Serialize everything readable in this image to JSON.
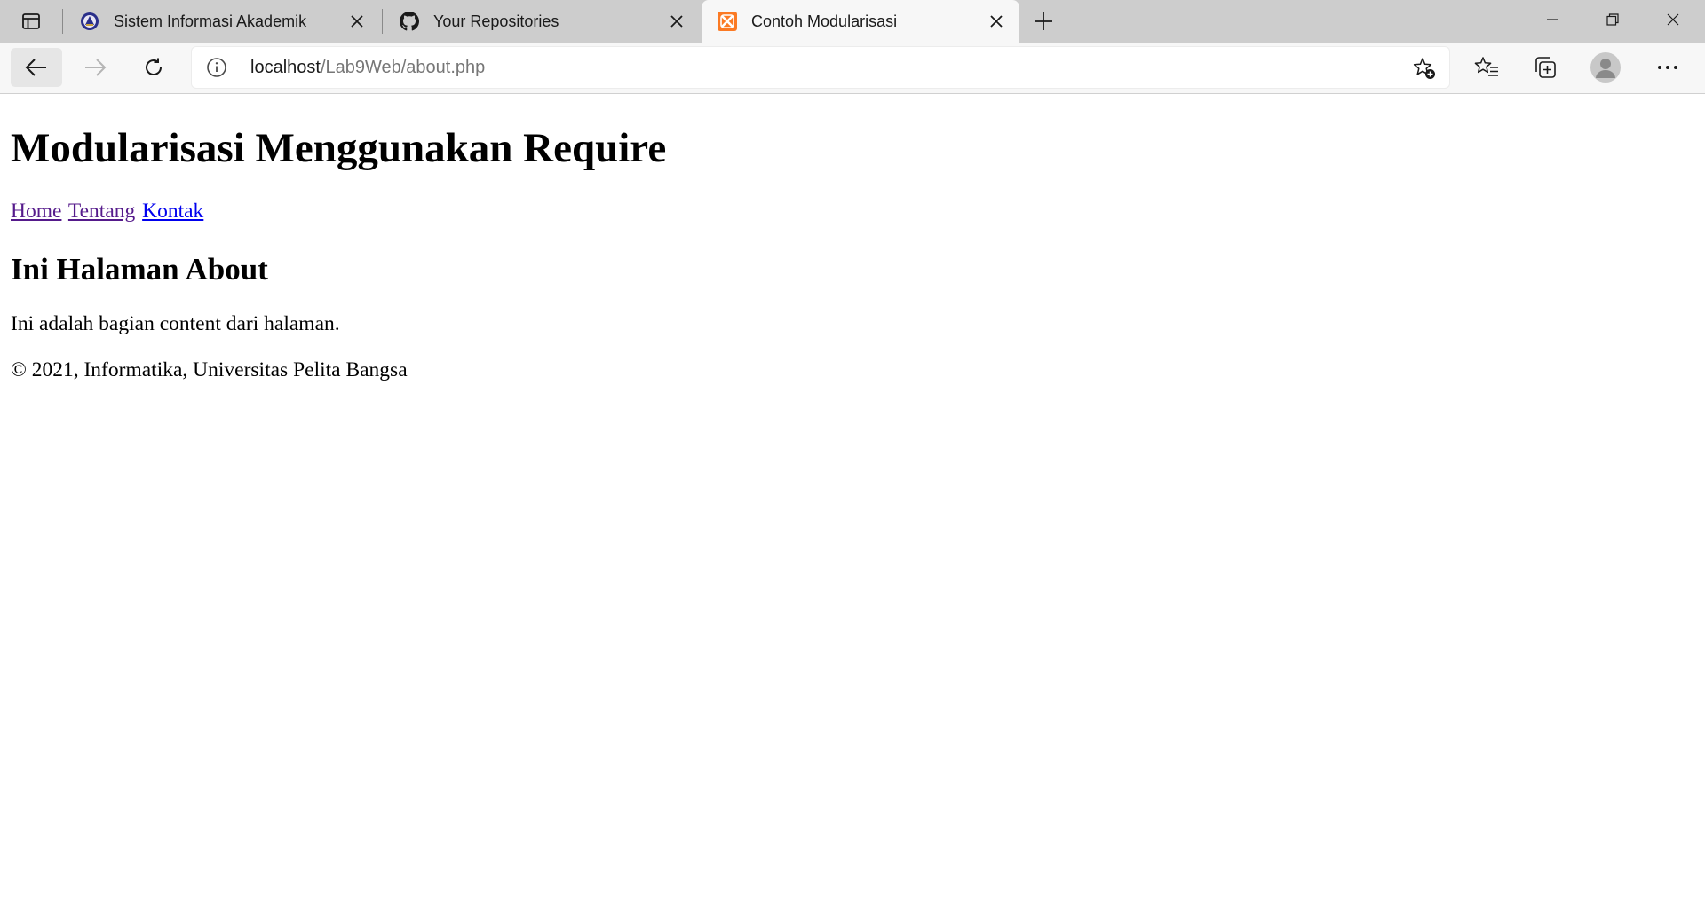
{
  "browser": {
    "tabs": [
      {
        "title": "Sistem Informasi Akademik",
        "favicon": "university-seal-icon",
        "active": false
      },
      {
        "title": "Your Repositories",
        "favicon": "github-icon",
        "active": false
      },
      {
        "title": "Contoh Modularisasi",
        "favicon": "xampp-icon",
        "active": true
      }
    ],
    "address": {
      "host": "localhost",
      "path": "/Lab9Web/about.php"
    },
    "colors": {
      "tabstrip": "#cdcdcd",
      "toolbar": "#f7f7f7",
      "xampp_orange": "#fb7a24",
      "link_visited": "#551a8b",
      "link_unvisited": "#0000ee"
    }
  },
  "page": {
    "heading": "Modularisasi Menggunakan Require",
    "nav": [
      {
        "label": "Home",
        "visited": true
      },
      {
        "label": "Tentang",
        "visited": true
      },
      {
        "label": "Kontak",
        "visited": false
      }
    ],
    "subheading": "Ini Halaman About",
    "content": "Ini adalah bagian content dari halaman.",
    "footer": "© 2021, Informatika, Universitas Pelita Bangsa"
  }
}
